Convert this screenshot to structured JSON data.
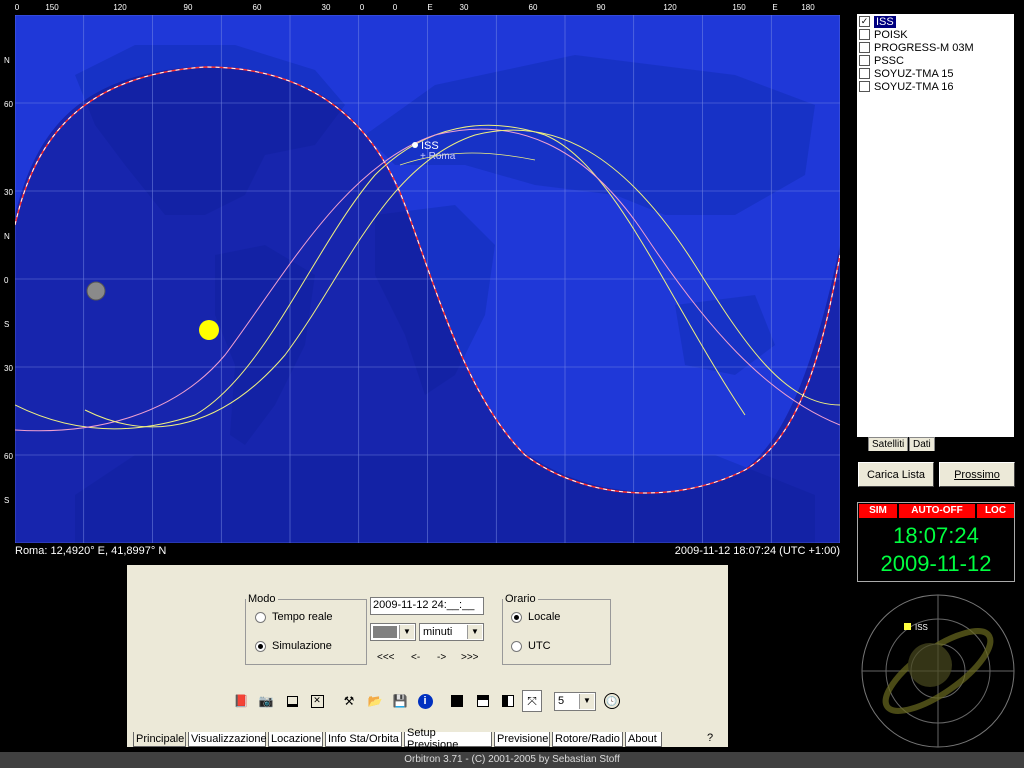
{
  "map": {
    "top_axis": [
      "0",
      "150",
      "120",
      "90",
      "60",
      "30",
      "0",
      "0",
      "E",
      "30",
      "60",
      "90",
      "120",
      "150",
      "E",
      "180"
    ],
    "left_axis": [
      "N",
      "60",
      "30",
      "N",
      "0",
      "S",
      "30",
      "60",
      "S"
    ],
    "iss_label": "ISS",
    "roma_label": "+ Roma",
    "location_text": "Roma: 12,4920° E, 41,8997° N",
    "datetime_text": "2009-11-12 18:07:24 (UTC +1:00)",
    "colors": {
      "ocean": "#1f38d8",
      "night": "#151a90",
      "land": "#1530c0",
      "grid": "#7f8fe8",
      "track_yellow": "#f0f080",
      "track_pink": "#f0a0d0",
      "terminator_red": "#ff3030"
    }
  },
  "satellites": [
    {
      "name": "ISS",
      "checked": true
    },
    {
      "name": "POISK",
      "checked": false
    },
    {
      "name": "PROGRESS-M 03M",
      "checked": false
    },
    {
      "name": "PSSC",
      "checked": false
    },
    {
      "name": "SOYUZ-TMA 15",
      "checked": false
    },
    {
      "name": "SOYUZ-TMA 16",
      "checked": false
    }
  ],
  "side_tabs": {
    "satelliti": "Satelliti",
    "dati": "Dati"
  },
  "buttons": {
    "load_list": "Carica Lista",
    "next": "Prossimo"
  },
  "clock": {
    "sim": "SIM",
    "auto_off": "AUTO-OFF",
    "loc": "LOC",
    "time": "18:07:24",
    "date": "2009-11-12",
    "colors": {
      "badge": "#ff0000",
      "digits": "#00ff40"
    }
  },
  "radar": {
    "sat_label": "ISS"
  },
  "panel": {
    "mode": {
      "title": "Modo",
      "realtime": "Tempo reale",
      "simulation": "Simulazione",
      "selected": "simulation"
    },
    "datetime_input": "2009-11-12 24:__:__",
    "step_unit": "minuti",
    "nav": [
      "<<<",
      "<-",
      "->",
      ">>>"
    ],
    "time_ref": {
      "title": "Orario",
      "local": "Locale",
      "utc": "UTC",
      "selected": "local"
    },
    "speed_value": "5",
    "toolbar_icons": [
      "book-icon",
      "camera-icon",
      "minimize-icon",
      "close-icon",
      "tools-icon",
      "open-folder-icon",
      "save-icon",
      "info-icon",
      "screen1-icon",
      "screen2-icon",
      "screen3-icon",
      "fullscreen-icon"
    ]
  },
  "tabs": [
    "Principale",
    "Visualizzazione",
    "Locazione",
    "Info Sta/Orbita",
    "Setup Previsione",
    "Previsione",
    "Rotore/Radio",
    "About"
  ],
  "help_label": "?",
  "status_bar": "Orbitron 3.71 - (C) 2001-2005 by Sebastian Stoff"
}
